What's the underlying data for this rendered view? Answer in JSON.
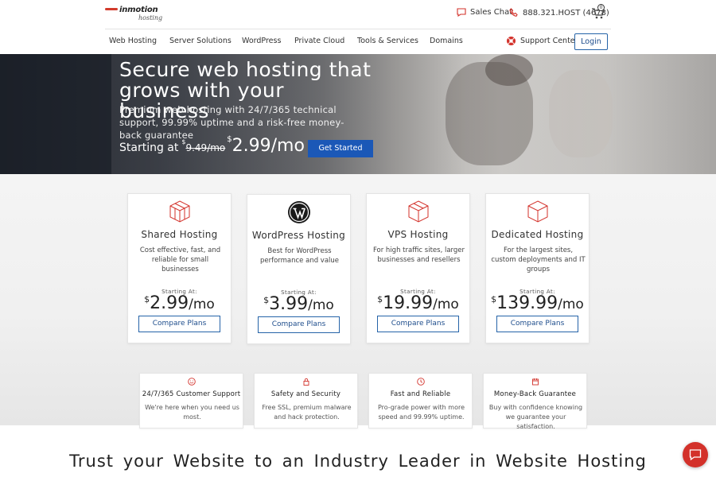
{
  "brand": {
    "logo_text": "inmotion",
    "logo_sub": "hosting",
    "accent_red": "#d3312a",
    "accent_blue": "#1b58b7"
  },
  "header": {
    "sales_chat": "Sales Chat",
    "phone": "888.321.HOST (4678)",
    "cart_count": "0"
  },
  "nav": {
    "items": [
      "Web Hosting",
      "Server Solutions",
      "WordPress",
      "Private Cloud",
      "Tools & Services",
      "Domains"
    ],
    "support": "Support Center",
    "login": "Login"
  },
  "hero": {
    "title": "Secure web hosting that grows with your business",
    "subtitle": "Premium web hosting with 24/7/365 technical support, 99.99% uptime and a risk-free money-back guarantee",
    "starting_label": "Starting at",
    "currency": "$",
    "old_price": "9.49/mo",
    "new_price": "2.99/mo",
    "cta": "Get Started"
  },
  "plans": [
    {
      "name": "Shared Hosting",
      "desc": "Cost effective, fast, and reliable for small businesses",
      "starting": "Starting At:",
      "currency": "$",
      "price": "2.99",
      "per": "/mo",
      "cta": "Compare Plans",
      "icon": "box-icon"
    },
    {
      "name": "WordPress Hosting",
      "desc": "Best for WordPress performance and value",
      "starting": "Starting At:",
      "currency": "$",
      "price": "3.99",
      "per": "/mo",
      "cta": "Compare Plans",
      "icon": "wordpress-icon"
    },
    {
      "name": "VPS Hosting",
      "desc": "For high traffic sites, larger businesses and resellers",
      "starting": "Starting At:",
      "currency": "$",
      "price": "19.99",
      "per": "/mo",
      "cta": "Compare Plans",
      "icon": "box-icon"
    },
    {
      "name": "Dedicated Hosting",
      "desc": "For the largest sites, custom deployments and IT groups",
      "starting": "Starting At:",
      "currency": "$",
      "price": "139.99",
      "per": "/mo",
      "cta": "Compare Plans",
      "icon": "box-icon"
    }
  ],
  "features": [
    {
      "title": "24/7/365 Customer Support",
      "desc": "We're here when you need us most.",
      "icon": "smiley-icon"
    },
    {
      "title": "Safety and Security",
      "desc": "Free SSL, premium malware and hack protection.",
      "icon": "lock-icon"
    },
    {
      "title": "Fast and Reliable",
      "desc": "Pro-grade power with more speed and 99.99% uptime.",
      "icon": "clock-icon"
    },
    {
      "title": "Money-Back Guarantee",
      "desc": "Buy with confidence knowing we guarantee your satisfaction.",
      "icon": "calendar-icon"
    }
  ],
  "trust_heading": "Trust your Website to an Industry Leader in Website Hosting"
}
